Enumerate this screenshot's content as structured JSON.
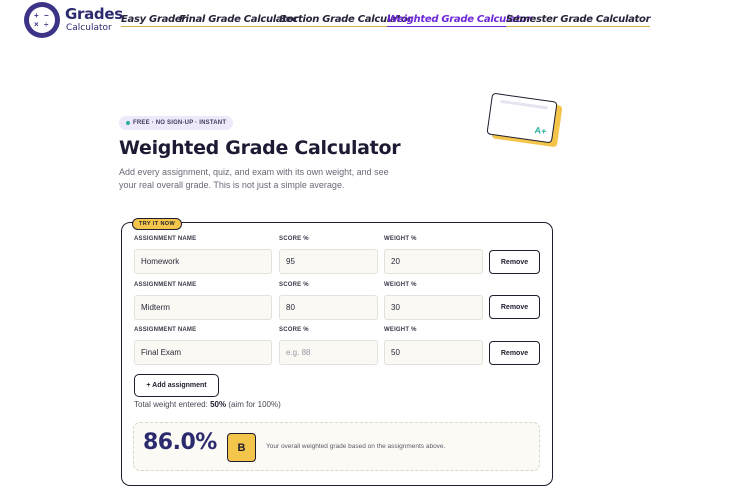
{
  "brand": {
    "name": "Grades",
    "tagline": "Calculator"
  },
  "nav": [
    {
      "label": "Easy Grader",
      "active": false
    },
    {
      "label": "Final Grade Calculator",
      "active": false
    },
    {
      "label": "Section Grade Calculator",
      "active": false
    },
    {
      "label": "Weighted Grade Calculator",
      "active": true
    },
    {
      "label": "Semester Grade Calculator",
      "active": false
    }
  ],
  "hero": {
    "badge": "FREE · NO SIGN-UP · INSTANT",
    "title": "Weighted Grade Calculator",
    "subtitle": "Add every assignment, quiz, and exam with its own weight, and see your real overall grade. This is not just a simple average.",
    "card_grade": "A+"
  },
  "calculator": {
    "tag": "TRY IT NOW",
    "headers": {
      "name": "ASSIGNMENT NAME",
      "score": "SCORE %",
      "weight": "WEIGHT %"
    },
    "rows": [
      {
        "name": "Homework",
        "score": "95",
        "score_placeholder": "",
        "weight": "20",
        "remove": "Remove"
      },
      {
        "name": "Midterm",
        "score": "80",
        "score_placeholder": "",
        "weight": "30",
        "remove": "Remove"
      },
      {
        "name": "Final Exam",
        "score": "",
        "score_placeholder": "e.g. 88",
        "weight": "50",
        "remove": "Remove"
      }
    ],
    "add_label": "+ Add assignment",
    "total_prefix": "Total weight entered:",
    "total_value": "50%",
    "total_suffix": "(aim for 100%)",
    "result": {
      "percent": "86.0%",
      "letter": "B",
      "description": "Your overall weighted grade based on the assignments above."
    }
  },
  "colors": {
    "brand": "#2b2a6e",
    "accent": "#f4c54b",
    "active_nav": "#6d28d9",
    "teal": "#2bb0a0"
  }
}
